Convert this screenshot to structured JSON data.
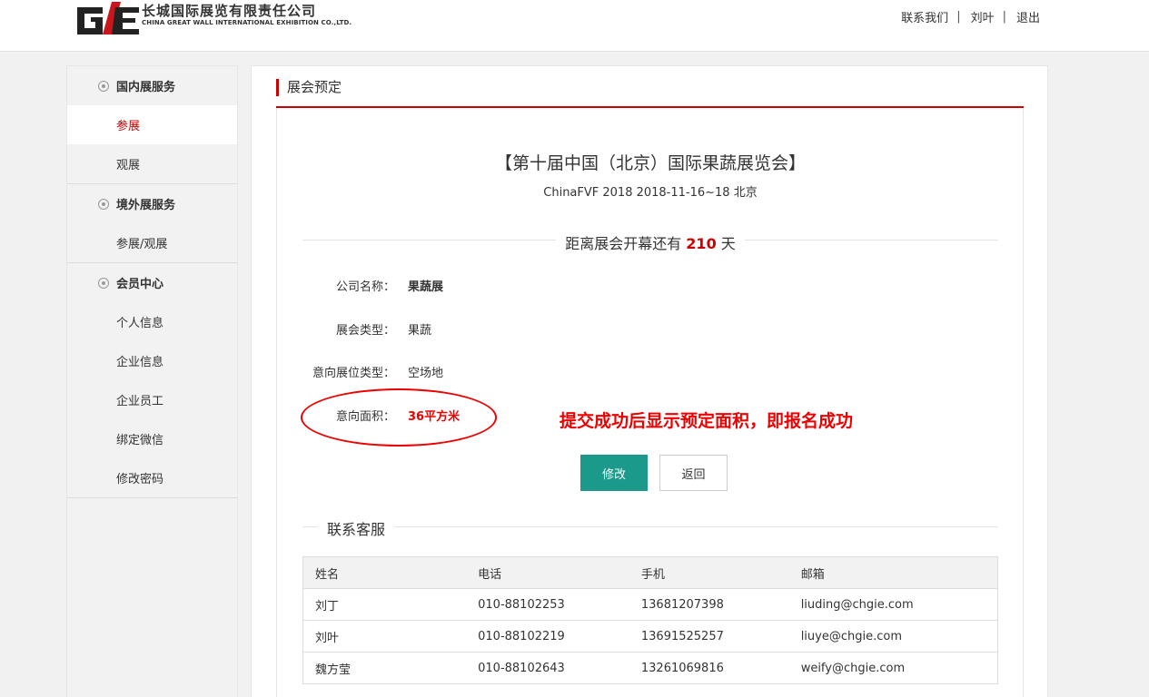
{
  "logo": {
    "cn": "长城国际展览有限责任公司",
    "en": "CHINA GREAT WALL INTERNATIONAL EXHIBITION CO.,LTD.",
    "mark_colors": {
      "red": "#c8161d",
      "dark": "#222222"
    }
  },
  "topnav": {
    "contact": "联系我们",
    "user": "刘叶",
    "logout": "退出",
    "separator": "|"
  },
  "sidebar": {
    "groups": [
      {
        "label": "国内展服务",
        "items": [
          "参展",
          "观展"
        ]
      },
      {
        "label": "境外展服务",
        "items": [
          "参展/观展"
        ]
      },
      {
        "label": "会员中心",
        "items": [
          "个人信息",
          "企业信息",
          "企业员工",
          "绑定微信",
          "修改密码"
        ]
      }
    ],
    "active_item": "参展"
  },
  "section": {
    "title": "展会预定"
  },
  "expo": {
    "title": "【第十届中国（北京）国际果蔬展览会】",
    "subtitle": "ChinaFVF 2018 2018-11-16~18 北京"
  },
  "countdown": {
    "prefix": "距离展会开幕还有",
    "days": "210",
    "suffix": "天"
  },
  "fields": [
    {
      "label": "公司名称：",
      "value": "果蔬展"
    },
    {
      "label": "展会类型：",
      "value": "果蔬"
    },
    {
      "label": "意向展位类型：",
      "value": "空场地"
    },
    {
      "label": "意向面积：",
      "value": "36平方米"
    }
  ],
  "annotation": "提交成功后显示预定面积，即报名成功",
  "buttons": {
    "edit": "修改",
    "back": "返回"
  },
  "contact": {
    "title": "联系客服",
    "headers": [
      "姓名",
      "电话",
      "手机",
      "邮箱"
    ],
    "rows": [
      [
        "刘丁",
        "010-88102253",
        "13681207398",
        "liuding@chgie.com"
      ],
      [
        "刘叶",
        "010-88102219",
        "13691525257",
        "liuye@chgie.com"
      ],
      [
        "魏方莹",
        "010-88102643",
        "13261069816",
        "weify@chgie.com"
      ]
    ]
  },
  "colors": {
    "accent_red": "#cc0000",
    "primary_button": "#1b9a8c"
  }
}
